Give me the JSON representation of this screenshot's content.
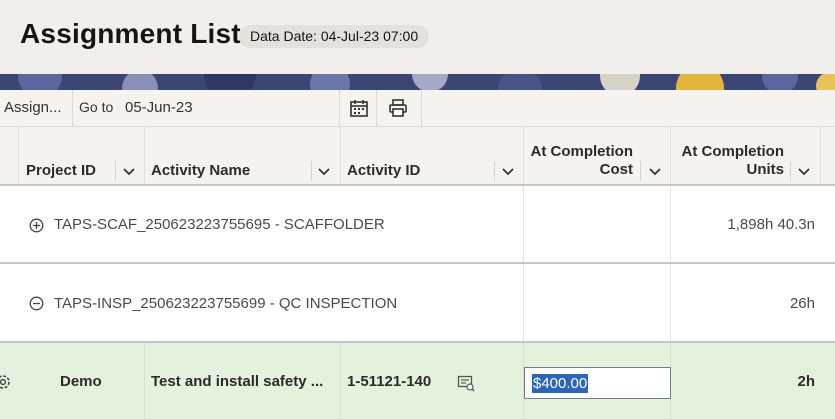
{
  "header": {
    "title": "Assignment List",
    "data_date": "Data Date: 04-Jul-23 07:00"
  },
  "toolbar": {
    "view_label": "Assign...",
    "goto_label": "Go to",
    "goto_value": "05-Jun-23",
    "calendar_icon": "calendar-icon",
    "print_icon": "print-icon"
  },
  "columns": {
    "project_id": "Project ID",
    "activity_name": "Activity Name",
    "activity_id": "Activity ID",
    "at_completion_cost_1": "At Completion",
    "at_completion_cost_2": "Cost",
    "at_completion_units_1": "At Completion",
    "at_completion_units_2": "Units"
  },
  "rows": [
    {
      "type": "wbs",
      "expanded": false,
      "label": "TAPS-SCAF_250623223755695 - SCAFFOLDER",
      "units": "1,898h 40.3n"
    },
    {
      "type": "wbs",
      "expanded": true,
      "label": "TAPS-INSP_250623223755699 - QC INSPECTION",
      "units": "26h"
    },
    {
      "type": "activity",
      "project_id": "Demo",
      "activity_name": "Test and install safety ...",
      "activity_id": "1-51121-140",
      "cost": "$400.00",
      "units": "2h"
    }
  ],
  "colors": {
    "selected_row": "#e3f2dc",
    "selection_highlight": "#2b66b8"
  }
}
